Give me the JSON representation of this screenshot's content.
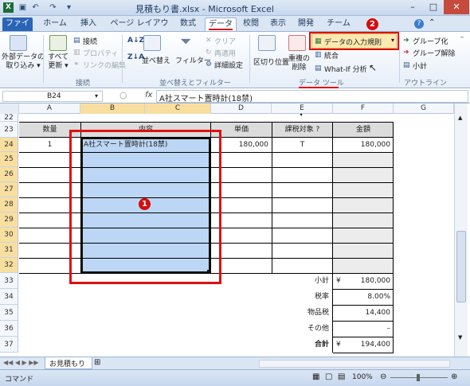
{
  "window": {
    "title": "見積もり書.xlsx - Microsoft Excel",
    "controls": {
      "minimize": "–",
      "maximize": "□",
      "close": "✕"
    }
  },
  "tabs": [
    {
      "label": "ファイル"
    },
    {
      "label": "ホーム"
    },
    {
      "label": "挿入"
    },
    {
      "label": "ページ レイアウト"
    },
    {
      "label": "数式"
    },
    {
      "label": "データ"
    },
    {
      "label": "校閲"
    },
    {
      "label": "表示"
    },
    {
      "label": "開発"
    },
    {
      "label": "チーム"
    }
  ],
  "ribbon": {
    "external": "外部データの\n取り込み ▾",
    "refresh_all": "すべて\n更新 ▾",
    "connections": "接続",
    "properties": "プロパティ",
    "edit_links": "リンクの編集",
    "group_connections": "接続",
    "sort_az": "A↓Z",
    "sort_za": "Z↓A",
    "sort": "並べ替え",
    "filter": "フィルター",
    "clear": "クリア",
    "reapply": "再適用",
    "advanced": "詳細設定",
    "group_sort_filter": "並べ替えとフィルター",
    "text_to_columns": "区切り位置",
    "remove_duplicates": "重複の\n削除",
    "data_validation": "データの入力規則",
    "consolidate": "統合",
    "what_if": "What-If 分析",
    "group_data_tools": "データ ツール",
    "group": "グループ化",
    "ungroup": "グループ解除",
    "subtotal": "小計",
    "group_outline": "アウトライン"
  },
  "formula_bar": {
    "name_box": "B24",
    "fx": "fx",
    "content": "A社スマート置時計(18禁)"
  },
  "columns": [
    "A",
    "B",
    "C",
    "D",
    "E",
    "F",
    "G"
  ],
  "rows": [
    "22",
    "23",
    "24",
    "25",
    "26",
    "27",
    "28",
    "29",
    "30",
    "31",
    "32",
    "33",
    "34",
    "35",
    "36",
    "37"
  ],
  "table_header": {
    "qty": "数量",
    "desc": "内容",
    "price": "単価",
    "tax": "課税対象 ?",
    "amount": "金額"
  },
  "row24": {
    "qty": "1",
    "desc": "A社スマート置時計(18禁)",
    "price": "180,000",
    "tax": "T",
    "amount": "180,000"
  },
  "totals": [
    {
      "label": "小計",
      "currency": "¥",
      "value": "180,000"
    },
    {
      "label": "税率",
      "currency": "",
      "value": "8.00%"
    },
    {
      "label": "物品税",
      "currency": "",
      "value": "14,400"
    },
    {
      "label": "その他",
      "currency": "",
      "value": "–"
    },
    {
      "label": "合計",
      "currency": "¥",
      "value": "194,400"
    }
  ],
  "sheet_tab": "お見積もり",
  "status": {
    "mode": "コマンド",
    "zoom": "100%"
  },
  "annotations": {
    "one": "1",
    "two": "2"
  },
  "colors": {
    "annotation": "#e01010",
    "selection": "#bcd7f5",
    "gray_fill": "#ececec"
  }
}
